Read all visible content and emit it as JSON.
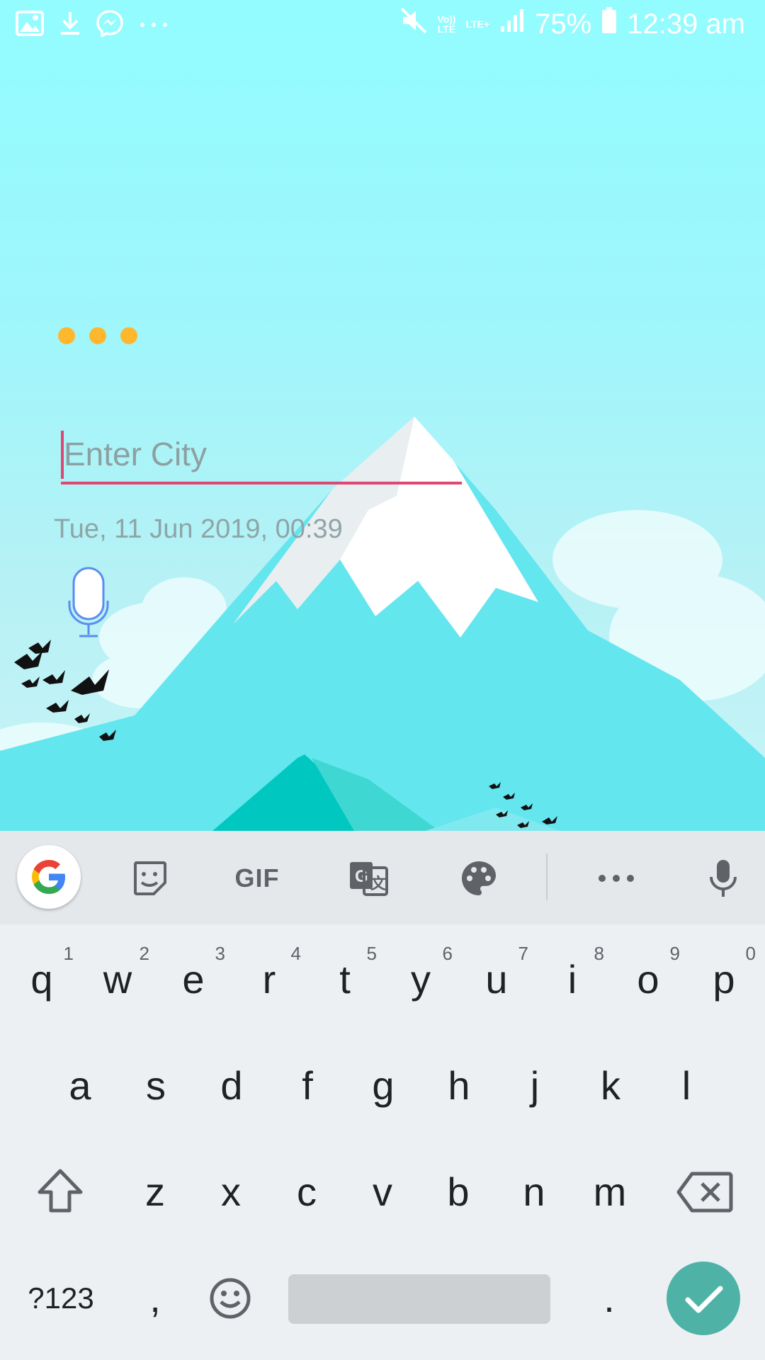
{
  "status_bar": {
    "icons_left": [
      "image-icon",
      "download-icon",
      "messenger-icon",
      "more-icon"
    ],
    "icons_right": [
      "mute-icon",
      "volte-icon",
      "lte-icon",
      "signal-icon",
      "battery-icon"
    ],
    "volte_text": "Vo))\nLTE",
    "lte_text": "LTE+",
    "battery": "75%",
    "time": "12:39 am"
  },
  "app": {
    "city_placeholder": "Enter City",
    "datetime": "Tue, 11 Jun 2019, 00:39",
    "colors": {
      "accent": "#e14573",
      "dots": "#ffb72d",
      "mic": "#5b8def"
    }
  },
  "keyboard": {
    "toolbar": {
      "items": [
        "google-icon",
        "sticker-icon",
        "gif",
        "translate-icon",
        "palette-icon",
        "more-icon",
        "mic-icon"
      ],
      "gif_label": "GIF"
    },
    "row1": [
      {
        "k": "q",
        "h": "1"
      },
      {
        "k": "w",
        "h": "2"
      },
      {
        "k": "e",
        "h": "3"
      },
      {
        "k": "r",
        "h": "4"
      },
      {
        "k": "t",
        "h": "5"
      },
      {
        "k": "y",
        "h": "6"
      },
      {
        "k": "u",
        "h": "7"
      },
      {
        "k": "i",
        "h": "8"
      },
      {
        "k": "o",
        "h": "9"
      },
      {
        "k": "p",
        "h": "0"
      }
    ],
    "row2": [
      "a",
      "s",
      "d",
      "f",
      "g",
      "h",
      "j",
      "k",
      "l"
    ],
    "row3": [
      "z",
      "x",
      "c",
      "v",
      "b",
      "n",
      "m"
    ],
    "symbols_label": "?123",
    "comma": ",",
    "period": ".",
    "enter_color": "#4eb3a6"
  }
}
